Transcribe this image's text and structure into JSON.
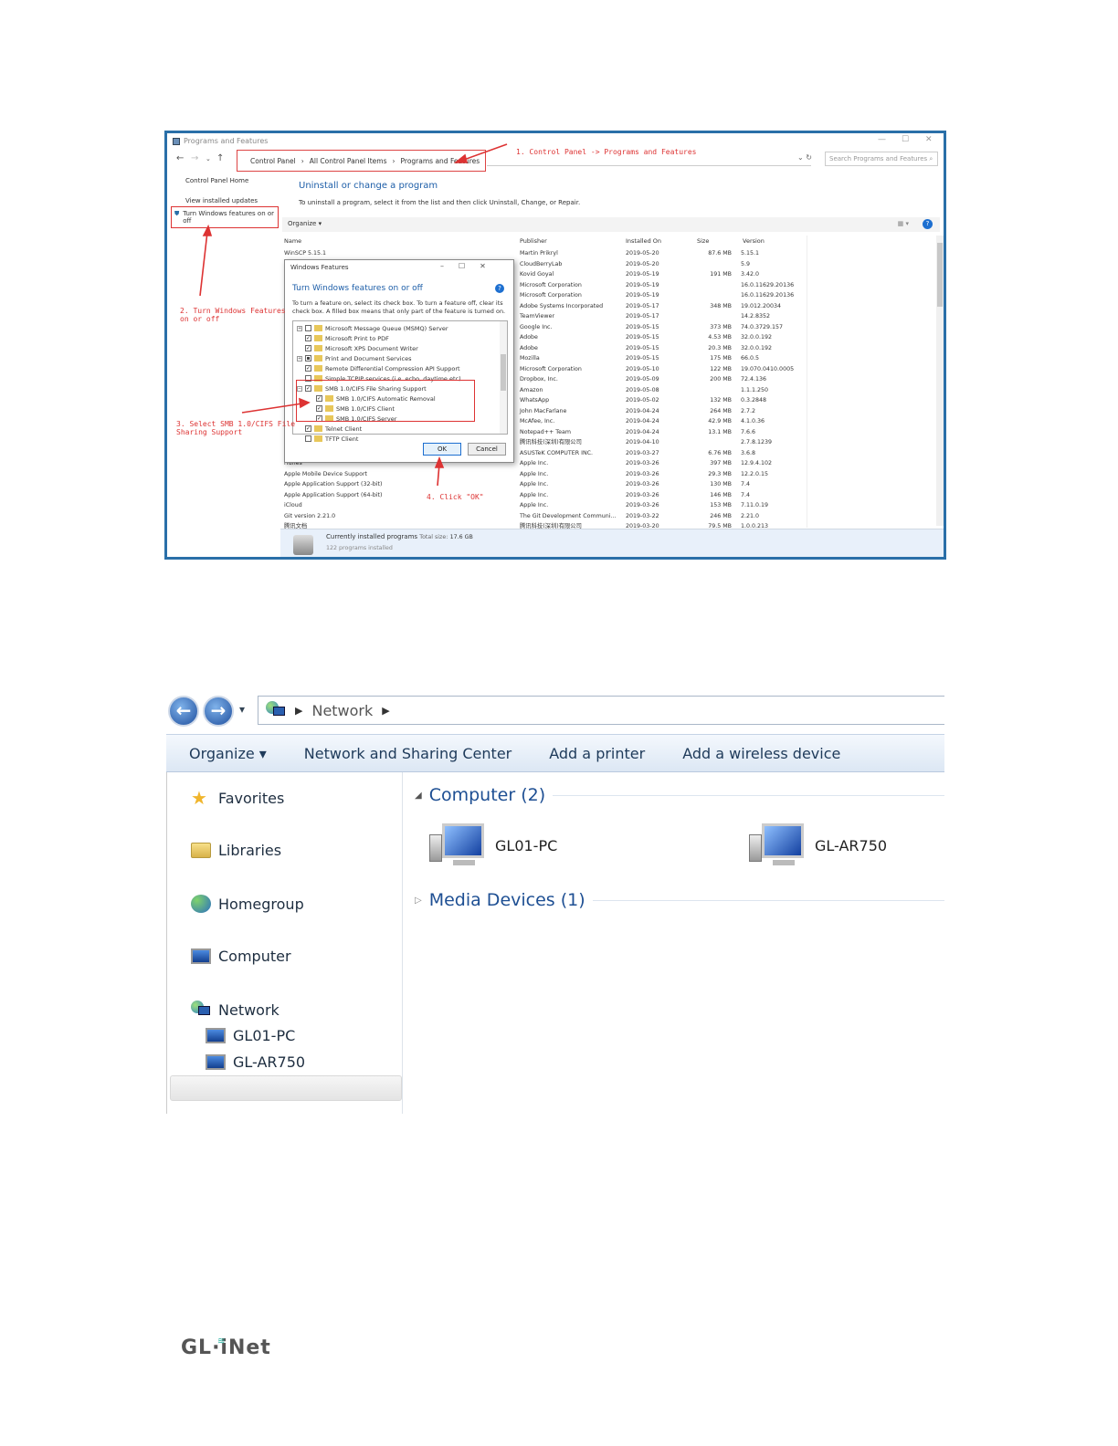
{
  "shot1": {
    "window_title": "Programs and Features",
    "breadcrumb": [
      "Control Panel",
      "All Control Panel Items",
      "Programs and Features"
    ],
    "search_placeholder": "Search Programs and Features",
    "left_links": [
      "Control Panel Home",
      "View installed updates",
      "Turn Windows features on or off"
    ],
    "heading": "Uninstall or change a program",
    "description": "To uninstall a program, select it from the list and then click Uninstall, Change, or Repair.",
    "organize_label": "Organize ▾",
    "columns": [
      "Name",
      "Publisher",
      "Installed On",
      "Size",
      "Version"
    ],
    "rows": [
      {
        "name": "WinSCP 5.15.1",
        "publisher": "Martin Prikryl",
        "date": "2019-05-20",
        "size": "87.6 MB",
        "version": "5.15.1"
      },
      {
        "name": "",
        "publisher": "CloudBerryLab",
        "date": "2019-05-20",
        "size": "",
        "version": "5.9"
      },
      {
        "name": "",
        "publisher": "Kovid Goyal",
        "date": "2019-05-19",
        "size": "191 MB",
        "version": "3.42.0"
      },
      {
        "name": "",
        "publisher": "Microsoft Corporation",
        "date": "2019-05-19",
        "size": "",
        "version": "16.0.11629.20136"
      },
      {
        "name": "",
        "publisher": "Microsoft Corporation",
        "date": "2019-05-19",
        "size": "",
        "version": "16.0.11629.20136"
      },
      {
        "name": "",
        "publisher": "Adobe Systems Incorporated",
        "date": "2019-05-17",
        "size": "348 MB",
        "version": "19.012.20034"
      },
      {
        "name": "",
        "publisher": "TeamViewer",
        "date": "2019-05-17",
        "size": "",
        "version": "14.2.8352"
      },
      {
        "name": "",
        "publisher": "Google Inc.",
        "date": "2019-05-15",
        "size": "373 MB",
        "version": "74.0.3729.157"
      },
      {
        "name": "",
        "publisher": "Adobe",
        "date": "2019-05-15",
        "size": "4.53 MB",
        "version": "32.0.0.192"
      },
      {
        "name": "",
        "publisher": "Adobe",
        "date": "2019-05-15",
        "size": "20.3 MB",
        "version": "32.0.0.192"
      },
      {
        "name": "",
        "publisher": "Mozilla",
        "date": "2019-05-15",
        "size": "175 MB",
        "version": "66.0.5"
      },
      {
        "name": "",
        "publisher": "Microsoft Corporation",
        "date": "2019-05-10",
        "size": "122 MB",
        "version": "19.070.0410.0005"
      },
      {
        "name": "",
        "publisher": "Dropbox, Inc.",
        "date": "2019-05-09",
        "size": "200 MB",
        "version": "72.4.136"
      },
      {
        "name": "",
        "publisher": "Amazon",
        "date": "2019-05-08",
        "size": "",
        "version": "1.1.1.250"
      },
      {
        "name": "",
        "publisher": "WhatsApp",
        "date": "2019-05-02",
        "size": "132 MB",
        "version": "0.3.2848"
      },
      {
        "name": "",
        "publisher": "John MacFarlane",
        "date": "2019-04-24",
        "size": "264 MB",
        "version": "2.7.2"
      },
      {
        "name": "",
        "publisher": "McAfee, Inc.",
        "date": "2019-04-24",
        "size": "42.9 MB",
        "version": "4.1.0.36"
      },
      {
        "name": "",
        "publisher": "Notepad++ Team",
        "date": "2019-04-24",
        "size": "13.1 MB",
        "version": "7.6.6"
      },
      {
        "name": "",
        "publisher": "腾讯科技(深圳)有限公司",
        "date": "2019-04-10",
        "size": "",
        "version": "2.7.8.1239"
      },
      {
        "name": "",
        "publisher": "ASUSTeK COMPUTER INC.",
        "date": "2019-03-27",
        "size": "6.76 MB",
        "version": "3.6.8"
      },
      {
        "name": "iTunes",
        "publisher": "Apple Inc.",
        "date": "2019-03-26",
        "size": "397 MB",
        "version": "12.9.4.102"
      },
      {
        "name": "Apple Mobile Device Support",
        "publisher": "Apple Inc.",
        "date": "2019-03-26",
        "size": "29.3 MB",
        "version": "12.2.0.15"
      },
      {
        "name": "Apple Application Support (32-bit)",
        "publisher": "Apple Inc.",
        "date": "2019-03-26",
        "size": "130 MB",
        "version": "7.4"
      },
      {
        "name": "Apple Application Support (64-bit)",
        "publisher": "Apple Inc.",
        "date": "2019-03-26",
        "size": "146 MB",
        "version": "7.4"
      },
      {
        "name": "iCloud",
        "publisher": "Apple Inc.",
        "date": "2019-03-26",
        "size": "153 MB",
        "version": "7.11.0.19"
      },
      {
        "name": "Git version 2.21.0",
        "publisher": "The Git Development Communi...",
        "date": "2019-03-22",
        "size": "246 MB",
        "version": "2.21.0"
      },
      {
        "name": "腾讯文档",
        "publisher": "腾讯科技(深圳)有限公司",
        "date": "2019-03-20",
        "size": "79.5 MB",
        "version": "1.0.0.213"
      }
    ],
    "status_title": "Currently installed programs",
    "status_total_label": "Total size:",
    "status_total": "17.6 GB",
    "status_count": "122 programs installed",
    "dialog": {
      "title": "Windows Features",
      "heading": "Turn Windows features on or off",
      "description": "To turn a feature on, select its check box. To turn a feature off, clear its check box. A filled box means that only part of the feature is turned on.",
      "features": [
        {
          "label": "Microsoft Message Queue (MSMQ) Server",
          "state": "off",
          "expand": "+",
          "indent": 0
        },
        {
          "label": "Microsoft Print to PDF",
          "state": "on",
          "expand": "",
          "indent": 0
        },
        {
          "label": "Microsoft XPS Document Writer",
          "state": "on",
          "expand": "",
          "indent": 0
        },
        {
          "label": "Print and Document Services",
          "state": "part",
          "expand": "+",
          "indent": 0
        },
        {
          "label": "Remote Differential Compression API Support",
          "state": "on",
          "expand": "",
          "indent": 0
        },
        {
          "label": "Simple TCPIP services (i.e. echo, daytime etc)",
          "state": "off",
          "expand": "",
          "indent": 0
        },
        {
          "label": "SMB 1.0/CIFS File Sharing Support",
          "state": "on",
          "expand": "−",
          "indent": 0
        },
        {
          "label": "SMB 1.0/CIFS Automatic Removal",
          "state": "on",
          "expand": "",
          "indent": 1
        },
        {
          "label": "SMB 1.0/CIFS Client",
          "state": "on",
          "expand": "",
          "indent": 1
        },
        {
          "label": "SMB 1.0/CIFS Server",
          "state": "on",
          "expand": "",
          "indent": 1
        },
        {
          "label": "Telnet Client",
          "state": "on",
          "expand": "",
          "indent": 0
        },
        {
          "label": "TFTP Client",
          "state": "off",
          "expand": "",
          "indent": 0
        }
      ],
      "ok": "OK",
      "cancel": "Cancel"
    },
    "annotations": {
      "a1": "1. Control Panel -> Programs and Features",
      "a2": "2. Turn Windows Features\non or off",
      "a3": "3. Select SMB 1.0/CIFS File\nSharing Support",
      "a4": "4. Click \"OK\""
    }
  },
  "shot2": {
    "address": "Network",
    "toolbar": [
      "Organize ▾",
      "Network and Sharing Center",
      "Add a printer",
      "Add a wireless device"
    ],
    "nav": [
      "Favorites",
      "Libraries",
      "Homegroup",
      "Computer",
      "Network"
    ],
    "nav_children": [
      "GL01-PC",
      "GL-AR750"
    ],
    "group_computer": "Computer (2)",
    "group_media": "Media Devices (1)",
    "computers": [
      "GL01-PC",
      "GL-AR750"
    ]
  },
  "logo": "GL·iNet",
  "colors": {
    "accent": "#1e4f93",
    "annotation": "#dd3333",
    "frame": "#2a6fa8"
  }
}
